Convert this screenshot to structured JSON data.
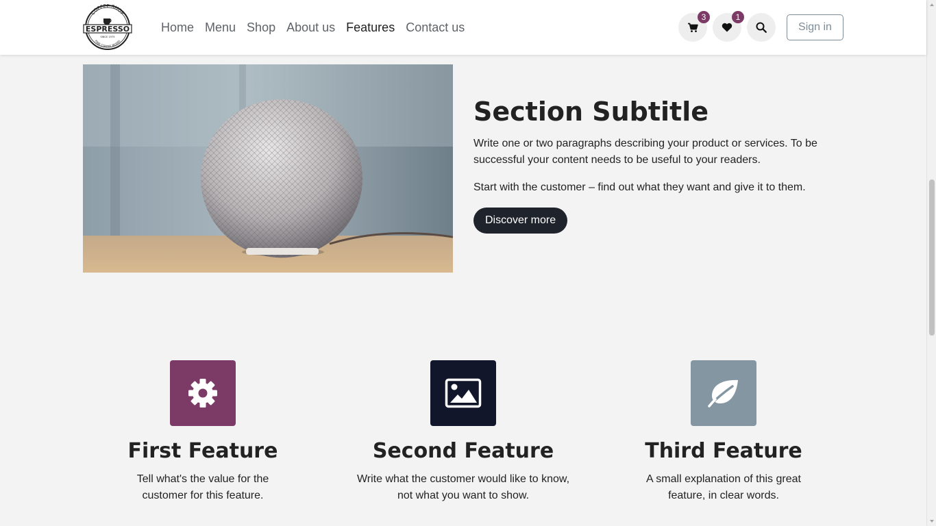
{
  "header": {
    "logo": {
      "top_text": "COFFEE SHOP",
      "main_text": "ESPRESSO",
      "since": "SINCE 1975",
      "tagline": "FINE COFFEE BEANS"
    },
    "nav": [
      {
        "label": "Home",
        "active": false
      },
      {
        "label": "Menu",
        "active": false
      },
      {
        "label": "Shop",
        "active": false
      },
      {
        "label": "About us",
        "active": false
      },
      {
        "label": "Features",
        "active": true
      },
      {
        "label": "Contact us",
        "active": false
      }
    ],
    "cart": {
      "icon": "cart-icon",
      "count": "3"
    },
    "wishlist": {
      "icon": "heart-icon",
      "count": "1"
    },
    "search": {
      "icon": "search-icon"
    },
    "signin_label": "Sign in"
  },
  "hero": {
    "title": "Section Subtitle",
    "paragraph1": "Write one or two paragraphs describing your product or services. To be successful your content needs to be useful to your readers.",
    "paragraph2": "Start with the customer – find out what they want and give it to them.",
    "button_label": "Discover more"
  },
  "features": [
    {
      "icon": "gear-icon",
      "color": "#7c3a66",
      "title": "First Feature",
      "desc_line1": "Tell what's the value for the",
      "desc_line2": "customer for this feature."
    },
    {
      "icon": "image-icon",
      "color": "#12162a",
      "title": "Second Feature",
      "desc_line1": "Write what the customer would like to know,",
      "desc_line2": "not what you want to show."
    },
    {
      "icon": "leaf-icon",
      "color": "#8596a3",
      "title": "Third Feature",
      "desc_line1": "A small explanation of this great",
      "desc_line2": "feature, in clear words."
    }
  ],
  "colors": {
    "accent": "#7c3a66",
    "dark": "#1f232c",
    "background": "#f3f3f3"
  }
}
